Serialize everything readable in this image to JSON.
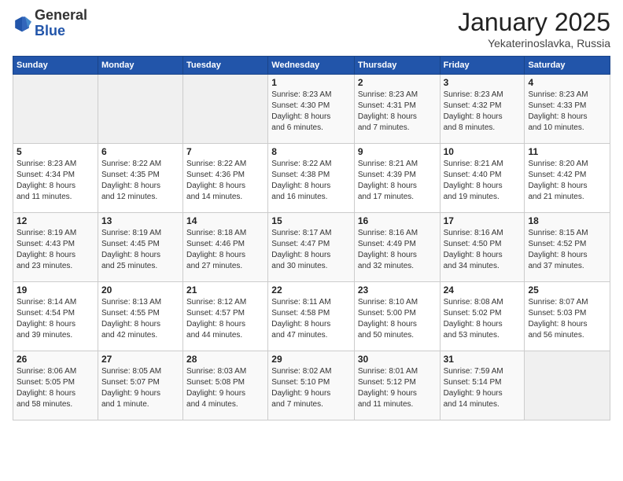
{
  "header": {
    "logo_general": "General",
    "logo_blue": "Blue",
    "month": "January 2025",
    "location": "Yekaterinoslavka, Russia"
  },
  "days_of_week": [
    "Sunday",
    "Monday",
    "Tuesday",
    "Wednesday",
    "Thursday",
    "Friday",
    "Saturday"
  ],
  "weeks": [
    [
      {
        "num": "",
        "detail": ""
      },
      {
        "num": "",
        "detail": ""
      },
      {
        "num": "",
        "detail": ""
      },
      {
        "num": "1",
        "detail": "Sunrise: 8:23 AM\nSunset: 4:30 PM\nDaylight: 8 hours\nand 6 minutes."
      },
      {
        "num": "2",
        "detail": "Sunrise: 8:23 AM\nSunset: 4:31 PM\nDaylight: 8 hours\nand 7 minutes."
      },
      {
        "num": "3",
        "detail": "Sunrise: 8:23 AM\nSunset: 4:32 PM\nDaylight: 8 hours\nand 8 minutes."
      },
      {
        "num": "4",
        "detail": "Sunrise: 8:23 AM\nSunset: 4:33 PM\nDaylight: 8 hours\nand 10 minutes."
      }
    ],
    [
      {
        "num": "5",
        "detail": "Sunrise: 8:23 AM\nSunset: 4:34 PM\nDaylight: 8 hours\nand 11 minutes."
      },
      {
        "num": "6",
        "detail": "Sunrise: 8:22 AM\nSunset: 4:35 PM\nDaylight: 8 hours\nand 12 minutes."
      },
      {
        "num": "7",
        "detail": "Sunrise: 8:22 AM\nSunset: 4:36 PM\nDaylight: 8 hours\nand 14 minutes."
      },
      {
        "num": "8",
        "detail": "Sunrise: 8:22 AM\nSunset: 4:38 PM\nDaylight: 8 hours\nand 16 minutes."
      },
      {
        "num": "9",
        "detail": "Sunrise: 8:21 AM\nSunset: 4:39 PM\nDaylight: 8 hours\nand 17 minutes."
      },
      {
        "num": "10",
        "detail": "Sunrise: 8:21 AM\nSunset: 4:40 PM\nDaylight: 8 hours\nand 19 minutes."
      },
      {
        "num": "11",
        "detail": "Sunrise: 8:20 AM\nSunset: 4:42 PM\nDaylight: 8 hours\nand 21 minutes."
      }
    ],
    [
      {
        "num": "12",
        "detail": "Sunrise: 8:19 AM\nSunset: 4:43 PM\nDaylight: 8 hours\nand 23 minutes."
      },
      {
        "num": "13",
        "detail": "Sunrise: 8:19 AM\nSunset: 4:45 PM\nDaylight: 8 hours\nand 25 minutes."
      },
      {
        "num": "14",
        "detail": "Sunrise: 8:18 AM\nSunset: 4:46 PM\nDaylight: 8 hours\nand 27 minutes."
      },
      {
        "num": "15",
        "detail": "Sunrise: 8:17 AM\nSunset: 4:47 PM\nDaylight: 8 hours\nand 30 minutes."
      },
      {
        "num": "16",
        "detail": "Sunrise: 8:16 AM\nSunset: 4:49 PM\nDaylight: 8 hours\nand 32 minutes."
      },
      {
        "num": "17",
        "detail": "Sunrise: 8:16 AM\nSunset: 4:50 PM\nDaylight: 8 hours\nand 34 minutes."
      },
      {
        "num": "18",
        "detail": "Sunrise: 8:15 AM\nSunset: 4:52 PM\nDaylight: 8 hours\nand 37 minutes."
      }
    ],
    [
      {
        "num": "19",
        "detail": "Sunrise: 8:14 AM\nSunset: 4:54 PM\nDaylight: 8 hours\nand 39 minutes."
      },
      {
        "num": "20",
        "detail": "Sunrise: 8:13 AM\nSunset: 4:55 PM\nDaylight: 8 hours\nand 42 minutes."
      },
      {
        "num": "21",
        "detail": "Sunrise: 8:12 AM\nSunset: 4:57 PM\nDaylight: 8 hours\nand 44 minutes."
      },
      {
        "num": "22",
        "detail": "Sunrise: 8:11 AM\nSunset: 4:58 PM\nDaylight: 8 hours\nand 47 minutes."
      },
      {
        "num": "23",
        "detail": "Sunrise: 8:10 AM\nSunset: 5:00 PM\nDaylight: 8 hours\nand 50 minutes."
      },
      {
        "num": "24",
        "detail": "Sunrise: 8:08 AM\nSunset: 5:02 PM\nDaylight: 8 hours\nand 53 minutes."
      },
      {
        "num": "25",
        "detail": "Sunrise: 8:07 AM\nSunset: 5:03 PM\nDaylight: 8 hours\nand 56 minutes."
      }
    ],
    [
      {
        "num": "26",
        "detail": "Sunrise: 8:06 AM\nSunset: 5:05 PM\nDaylight: 8 hours\nand 58 minutes."
      },
      {
        "num": "27",
        "detail": "Sunrise: 8:05 AM\nSunset: 5:07 PM\nDaylight: 9 hours\nand 1 minute."
      },
      {
        "num": "28",
        "detail": "Sunrise: 8:03 AM\nSunset: 5:08 PM\nDaylight: 9 hours\nand 4 minutes."
      },
      {
        "num": "29",
        "detail": "Sunrise: 8:02 AM\nSunset: 5:10 PM\nDaylight: 9 hours\nand 7 minutes."
      },
      {
        "num": "30",
        "detail": "Sunrise: 8:01 AM\nSunset: 5:12 PM\nDaylight: 9 hours\nand 11 minutes."
      },
      {
        "num": "31",
        "detail": "Sunrise: 7:59 AM\nSunset: 5:14 PM\nDaylight: 9 hours\nand 14 minutes."
      },
      {
        "num": "",
        "detail": ""
      }
    ]
  ]
}
